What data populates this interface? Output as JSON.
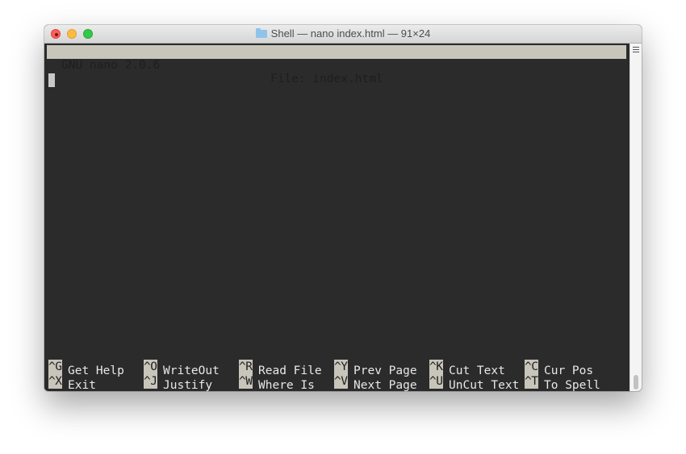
{
  "window": {
    "title": "Shell — nano index.html — 91×24",
    "title_icon": "folder-icon",
    "controls": [
      "close",
      "minimize",
      "maximize"
    ]
  },
  "nano": {
    "version_label": "GNU nano 2.0.6",
    "file_label": "File: index.html",
    "buffer_text": ""
  },
  "shortcuts": {
    "row1": [
      {
        "key": "^G",
        "label": "Get Help"
      },
      {
        "key": "^O",
        "label": "WriteOut"
      },
      {
        "key": "^R",
        "label": "Read File"
      },
      {
        "key": "^Y",
        "label": "Prev Page"
      },
      {
        "key": "^K",
        "label": "Cut Text"
      },
      {
        "key": "^C",
        "label": "Cur Pos"
      }
    ],
    "row2": [
      {
        "key": "^X",
        "label": "Exit"
      },
      {
        "key": "^J",
        "label": "Justify"
      },
      {
        "key": "^W",
        "label": "Where Is"
      },
      {
        "key": "^V",
        "label": "Next Page"
      },
      {
        "key": "^U",
        "label": "UnCut Text"
      },
      {
        "key": "^T",
        "label": "To Spell"
      }
    ]
  },
  "colors": {
    "terminal_bg": "#2b2b2b",
    "highlight_bg": "#c8c6bb",
    "text": "#e8e8e8"
  }
}
